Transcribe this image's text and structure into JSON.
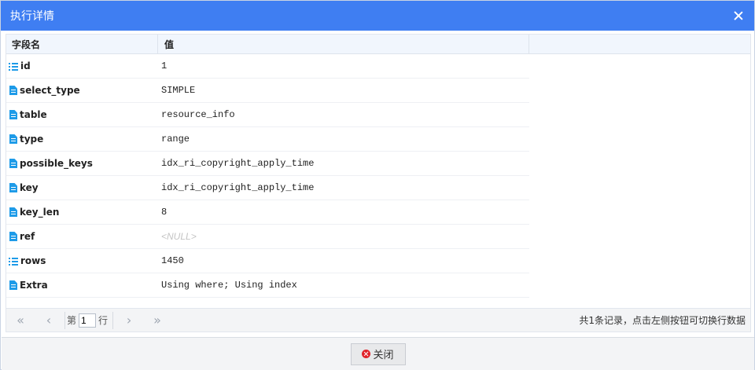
{
  "dialog": {
    "title": "执行详情",
    "close_icon": "close-icon"
  },
  "grid": {
    "columns": [
      "字段名",
      "值"
    ],
    "rows": [
      {
        "field": "id",
        "value": "1",
        "icon": "list-icon"
      },
      {
        "field": "select_type",
        "value": "SIMPLE",
        "icon": "document-icon"
      },
      {
        "field": "table",
        "value": "resource_info",
        "icon": "document-icon"
      },
      {
        "field": "type",
        "value": "range",
        "icon": "document-icon"
      },
      {
        "field": "possible_keys",
        "value": "idx_ri_copyright_apply_time",
        "icon": "document-icon"
      },
      {
        "field": "key",
        "value": "idx_ri_copyright_apply_time",
        "icon": "document-icon"
      },
      {
        "field": "key_len",
        "value": "8",
        "icon": "document-icon"
      },
      {
        "field": "ref",
        "value": "<NULL>",
        "icon": "document-icon",
        "is_null": true
      },
      {
        "field": "rows",
        "value": "1450",
        "icon": "list-icon"
      },
      {
        "field": "Extra",
        "value": "Using where; Using index",
        "icon": "document-icon"
      }
    ]
  },
  "pager": {
    "page_prefix": "第",
    "page_value": "1",
    "page_suffix": "行",
    "info": "共1条记录，点击左侧按钮可切换行数据",
    "first_icon": "double-chevron-left-icon",
    "prev_icon": "chevron-left-icon",
    "next_icon": "chevron-right-icon",
    "last_icon": "double-chevron-right-icon"
  },
  "footer": {
    "close_label": "关闭",
    "close_icon": "close-circle-icon"
  },
  "colors": {
    "titlebar": "#3f7ef2",
    "icon": "#1e9be8",
    "close_circle": "#e0232b",
    "bg_tab_colors": [
      "#1e9be8",
      "#19b6a6",
      "#19b6a6",
      "#19b6a6"
    ]
  }
}
